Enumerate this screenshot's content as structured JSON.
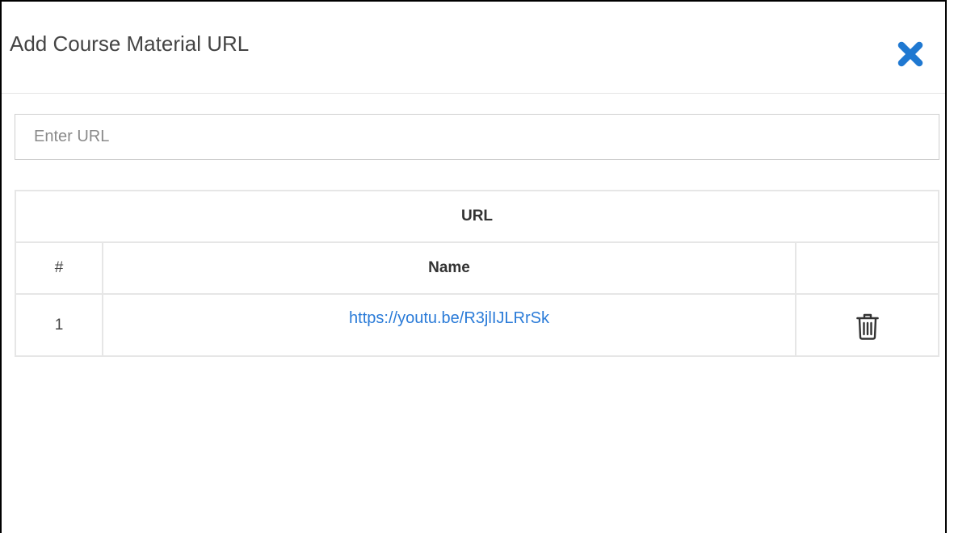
{
  "dialog": {
    "title": "Add Course Material URL",
    "close_icon": "close-x-icon",
    "accent_color": "#1f78d1"
  },
  "url_input": {
    "placeholder": "Enter URL",
    "value": ""
  },
  "table": {
    "caption": "URL",
    "headers": {
      "number": "#",
      "name": "Name",
      "action": ""
    },
    "rows": [
      {
        "number": "1",
        "name": "https://youtu.be/R3jlIJLRrSk",
        "action_icon": "trash-icon"
      }
    ],
    "link_color": "#2a7bd8"
  }
}
